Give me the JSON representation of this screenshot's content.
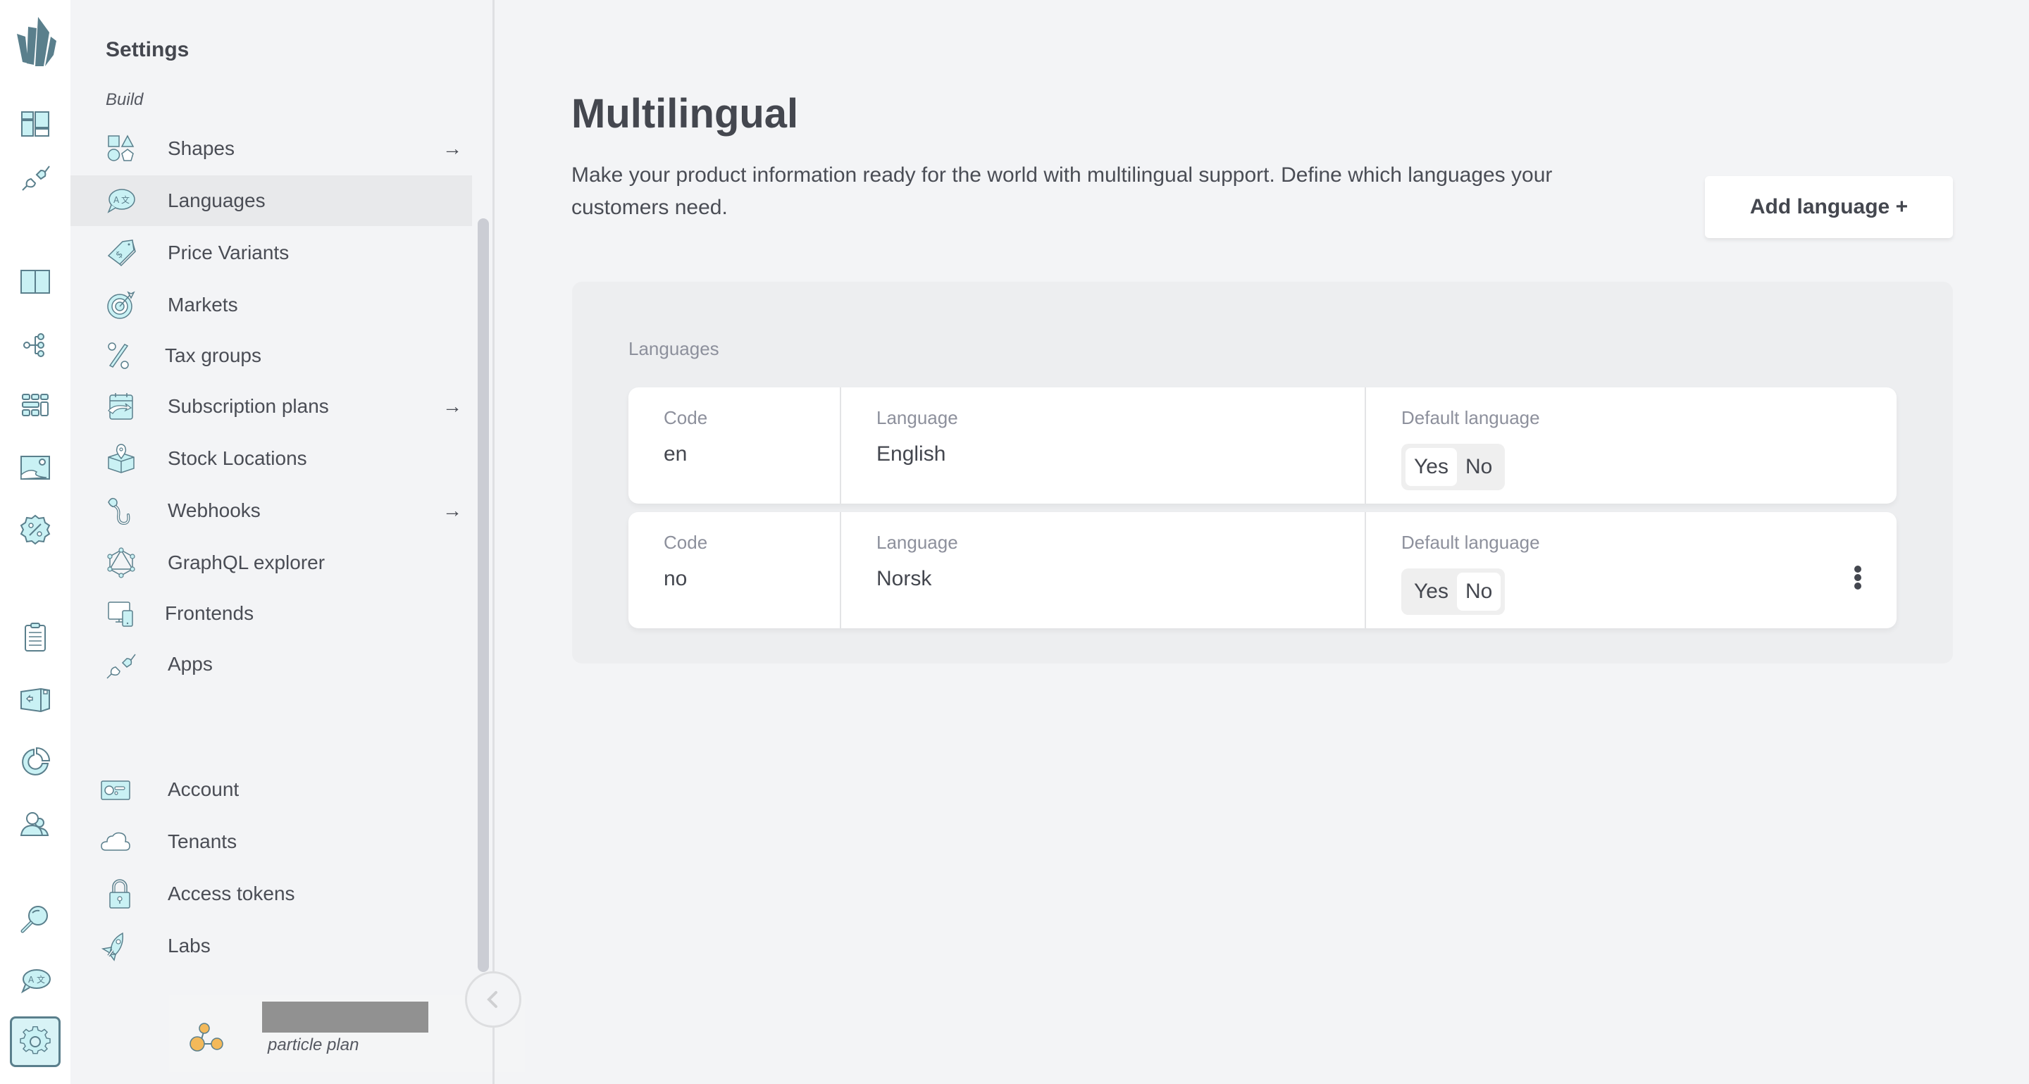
{
  "rail": {
    "items": [
      {
        "name": "dashboard",
        "icon": "dashboard-icon"
      },
      {
        "name": "apps",
        "icon": "plug-icon"
      },
      {
        "name": "catalogue",
        "icon": "book-icon"
      },
      {
        "name": "topics",
        "icon": "tree-icon"
      },
      {
        "name": "grids",
        "icon": "grid-icon"
      },
      {
        "name": "assets",
        "icon": "image-icon"
      },
      {
        "name": "promotions",
        "icon": "discount-badge-icon"
      },
      {
        "name": "orders",
        "icon": "clipboard-icon"
      },
      {
        "name": "fulfilment",
        "icon": "box-icon"
      },
      {
        "name": "reports",
        "icon": "pie-chart-icon"
      },
      {
        "name": "customers",
        "icon": "users-icon"
      },
      {
        "name": "search",
        "icon": "search-icon"
      },
      {
        "name": "translate",
        "icon": "translate-icon"
      },
      {
        "name": "settings",
        "icon": "gear-icon",
        "active": true
      }
    ]
  },
  "sidebar": {
    "title": "Settings",
    "section": "Build",
    "items": [
      {
        "label": "Shapes",
        "icon": "shapes-icon",
        "arrow": "→"
      },
      {
        "label": "Languages",
        "icon": "translate-icon",
        "active": true
      },
      {
        "label": "Price Variants",
        "icon": "price-tag-icon"
      },
      {
        "label": "Markets",
        "icon": "target-icon"
      },
      {
        "label": "Tax groups",
        "icon": "percent-icon"
      },
      {
        "label": "Subscription plans",
        "icon": "calendar-sync-icon",
        "arrow": "→"
      },
      {
        "label": "Stock Locations",
        "icon": "box-location-icon"
      },
      {
        "label": "Webhooks",
        "icon": "hook-icon",
        "arrow": "→"
      },
      {
        "label": "GraphQL explorer",
        "icon": "graphql-icon"
      },
      {
        "label": "Frontends",
        "icon": "devices-icon"
      },
      {
        "label": "Apps",
        "icon": "plug-icon"
      }
    ],
    "account_items": [
      {
        "label": "Account",
        "icon": "id-card-icon"
      },
      {
        "label": "Tenants",
        "icon": "cloud-icon"
      },
      {
        "label": "Access tokens",
        "icon": "lock-icon"
      },
      {
        "label": "Labs",
        "icon": "rocket-icon"
      }
    ],
    "tenant": {
      "plan": "particle plan"
    },
    "collapse_label": "‹"
  },
  "main": {
    "title": "Multilingual",
    "description": "Make your product information ready for the world with multilingual support. Define which languages your customers need.",
    "add_button": "Add language +",
    "panel_label": "Languages",
    "columns": {
      "code": "Code",
      "language": "Language",
      "default": "Default language"
    },
    "toggle_options": {
      "yes": "Yes",
      "no": "No"
    },
    "rows": [
      {
        "code": "en",
        "language": "English",
        "default": "Yes",
        "has_menu": false
      },
      {
        "code": "no",
        "language": "Norsk",
        "default": "No",
        "has_menu": true
      }
    ]
  }
}
